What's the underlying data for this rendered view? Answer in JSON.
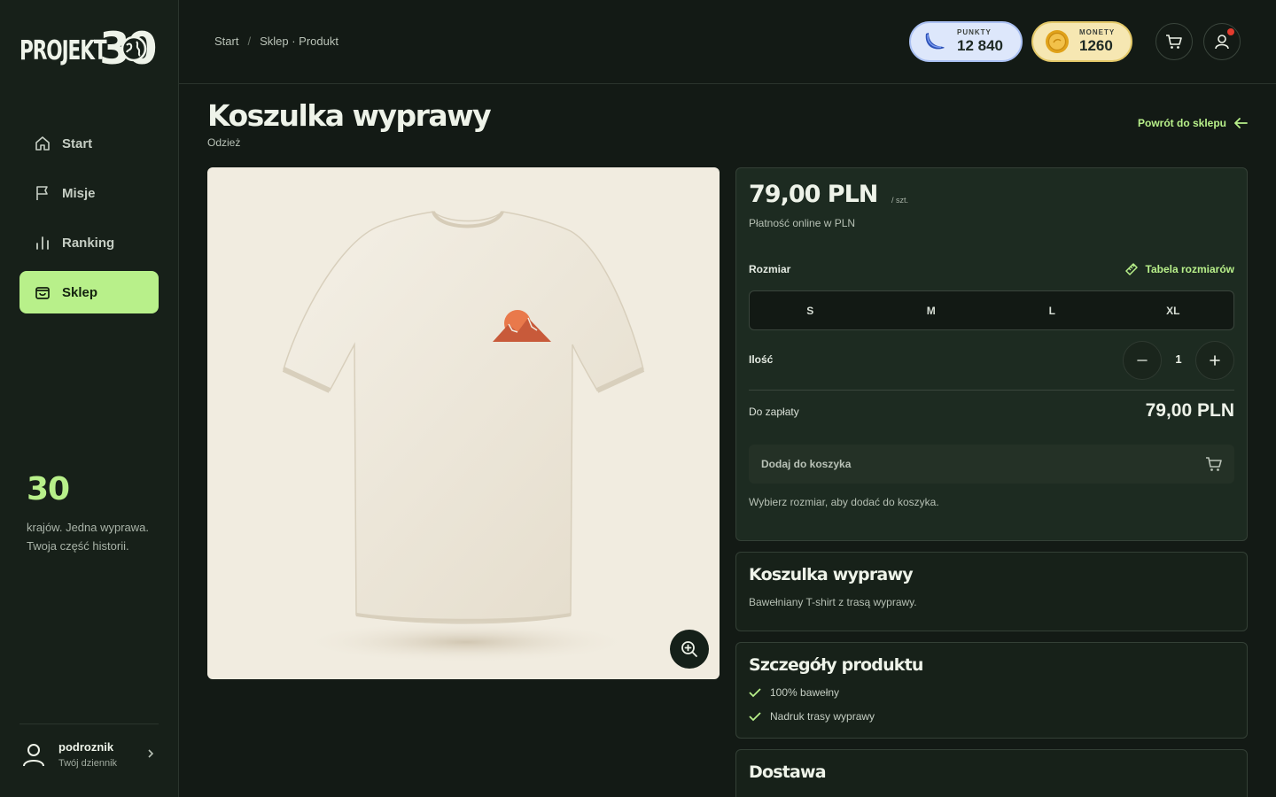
{
  "brand": {
    "logo_text": "PROJEKT",
    "logo_number": "30"
  },
  "sidebar": {
    "items": [
      {
        "label": "Start",
        "icon": "home-icon",
        "active": false
      },
      {
        "label": "Misje",
        "icon": "flag-icon",
        "active": false
      },
      {
        "label": "Ranking",
        "icon": "bar-chart-icon",
        "active": false
      },
      {
        "label": "Sklep",
        "icon": "shopping-bag-icon",
        "active": true
      }
    ],
    "promo": {
      "number": "30",
      "text_line1": "krajów. Jedna wyprawa.",
      "text_line2": "Twoja część historii."
    },
    "user": {
      "name": "podroznik",
      "subtitle": "Twój dziennik"
    }
  },
  "header": {
    "breadcrumb": {
      "home": "Start",
      "separator": "/",
      "current": "Sklep · Produkt"
    },
    "points": {
      "label": "PUNKTY",
      "value": "12 840",
      "icon": "banana-icon"
    },
    "coins": {
      "label": "MONETY",
      "value": "1260",
      "icon": "coin-icon"
    }
  },
  "product": {
    "title": "Koszulka wyprawy",
    "category": "Odzież",
    "back_label": "Powrót do sklepu",
    "price": "79,00 PLN",
    "price_unit": "/ szt.",
    "payment_note": "Płatność online w PLN",
    "size_label": "Rozmiar",
    "size_table_label": "Tabela rozmiarów",
    "sizes": [
      "S",
      "M",
      "L",
      "XL"
    ],
    "quantity_label": "Ilość",
    "quantity": "1",
    "total_label": "Do zapłaty",
    "total": "79,00 PLN",
    "add_to_cart_label": "Dodaj do koszyka",
    "hint": "Wybierz rozmiar, aby dodać do koszyka.",
    "description_title": "Koszulka wyprawy",
    "description": "Bawełniany T-shirt z trasą wyprawy.",
    "details_title": "Szczegóły produktu",
    "details": [
      "100% bawełny",
      "Nadruk trasy wyprawy"
    ],
    "shipping_title": "Dostawa"
  },
  "colors": {
    "accent": "#b8f08a",
    "background": "#131a15",
    "card": "#1d2b21",
    "notification": "#e23b2e"
  }
}
